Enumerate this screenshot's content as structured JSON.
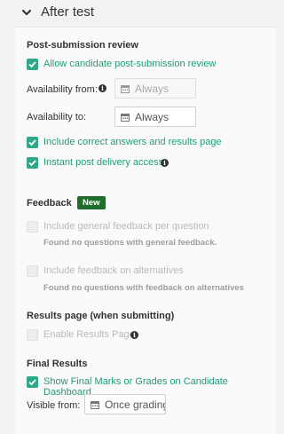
{
  "header": {
    "title": "After test",
    "icon": "chevron-down-icon"
  },
  "post_submission": {
    "heading": "Post-submission review",
    "allow_label": "Allow candidate post-submission review",
    "availability_from_label": "Availability from:",
    "availability_from_value": "Always",
    "availability_to_label": "Availability to:",
    "availability_to_value": "Always",
    "include_correct_label": "Include correct answers and results page",
    "instant_access_label": "Instant post delivery access"
  },
  "feedback": {
    "heading": "Feedback",
    "badge": "New",
    "general_label": "Include general feedback per question",
    "general_note": "Found no questions with general feedback.",
    "alternatives_label": "Include feedback on alternatives",
    "alternatives_note": "Found no questions with feedback on alternatives"
  },
  "results_page": {
    "heading": "Results page (when submitting)",
    "enable_label": "Enable Results Page"
  },
  "final_results": {
    "heading": "Final Results",
    "show_label": "Show Final Marks or Grades on Candidate Dashboard",
    "visible_from_label": "Visible from:",
    "visible_from_value": "Once grading"
  },
  "colors": {
    "accent": "#2fa88a",
    "badge": "#1f6e2c"
  }
}
